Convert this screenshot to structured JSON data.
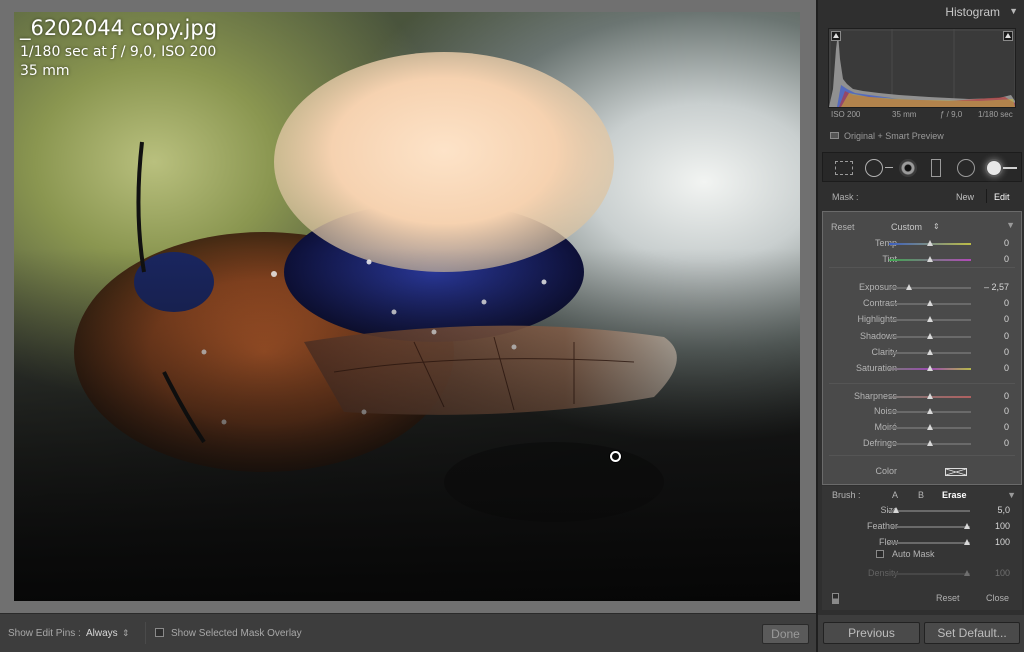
{
  "photo": {
    "filename": "_6202044 copy.jpg",
    "exposure_info": "1/180 sec at ƒ / 9,0, ISO 200",
    "focal_length": "35 mm"
  },
  "toolbar": {
    "show_edit_pins_label": "Show Edit Pins :",
    "show_edit_pins_value": "Always",
    "show_edit_pins_arrow": "⇕",
    "mask_overlay_label": "Show Selected Mask Overlay",
    "done_label": "Done"
  },
  "histogram": {
    "title": "Histogram",
    "collapse_glyph": "▼",
    "iso": "ISO 200",
    "focal": "35 mm",
    "aperture": "ƒ / 9,0",
    "shutter": "1/180 sec",
    "preview_label": "Original + Smart Preview"
  },
  "mask": {
    "label": "Mask :",
    "new_label": "New",
    "edit_label": "Edit"
  },
  "adjustments": {
    "effect_label": "Reset",
    "effect_value": "Custom",
    "effect_arrow": "⇕",
    "collapse_glyph": "▼",
    "sliders": [
      {
        "label": "Temp",
        "value": "0",
        "pos": 0.5
      },
      {
        "label": "Tint",
        "value": "0",
        "pos": 0.5
      },
      {
        "label": "Exposure",
        "value": "– 2,57",
        "pos": 0.24
      },
      {
        "label": "Contrast",
        "value": "0",
        "pos": 0.5
      },
      {
        "label": "Highlights",
        "value": "0",
        "pos": 0.5
      },
      {
        "label": "Shadows",
        "value": "0",
        "pos": 0.5
      },
      {
        "label": "Clarity",
        "value": "0",
        "pos": 0.5
      },
      {
        "label": "Saturation",
        "value": "0",
        "pos": 0.5
      },
      {
        "label": "Sharpness",
        "value": "0",
        "pos": 0.5
      },
      {
        "label": "Noise",
        "value": "0",
        "pos": 0.5
      },
      {
        "label": "Moiré",
        "value": "0",
        "pos": 0.5
      },
      {
        "label": "Defringe",
        "value": "0",
        "pos": 0.5
      }
    ],
    "color_label": "Color"
  },
  "brush": {
    "label": "Brush :",
    "tab_a": "A",
    "tab_b": "B",
    "tab_erase": "Erase",
    "collapse_glyph": "▼",
    "sliders": [
      {
        "label": "Size",
        "value": "5,0",
        "pos": 0.1
      },
      {
        "label": "Feather",
        "value": "100",
        "pos": 0.96
      },
      {
        "label": "Flow",
        "value": "100",
        "pos": 0.96
      }
    ],
    "automask_label": "Auto Mask",
    "density_label": "Density",
    "density_value": "100",
    "density_pos": 0.96
  },
  "panel_footer": {
    "reset_label": "Reset",
    "close_label": "Close"
  },
  "bottom_buttons": {
    "previous_label": "Previous",
    "set_default_label": "Set Default..."
  },
  "colors": {
    "panel_bg": "#2f2f2f",
    "accent": "#ffffff"
  }
}
